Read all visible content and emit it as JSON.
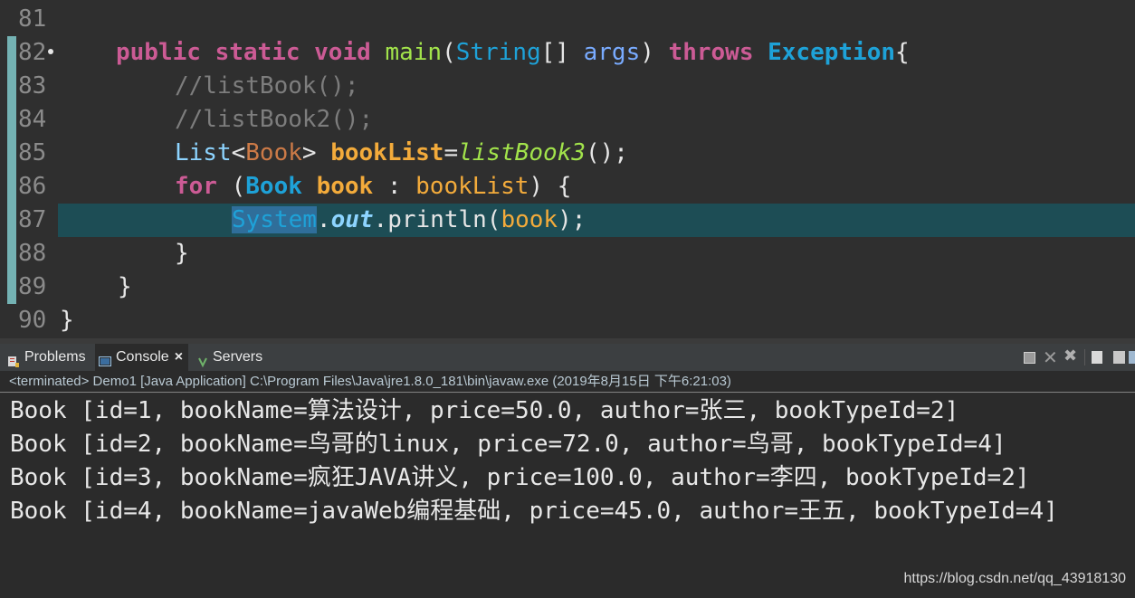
{
  "editor": {
    "line_numbers": [
      "81",
      "82",
      "83",
      "84",
      "85",
      "86",
      "87",
      "88",
      "89",
      "90"
    ],
    "line82": {
      "public": "public",
      "static": "static",
      "void": "void",
      "main": "main",
      "paren": "(",
      "string": "String",
      "arr": "[] ",
      "args": "args",
      "close": ") ",
      "throws": "throws",
      "exception": "Exception",
      "brace": "{"
    },
    "line83": "//listBook();",
    "line84": "//listBook2();",
    "line85": {
      "list": "List",
      "lt": "<",
      "book": "Book",
      "gt": "> ",
      "var": "bookList",
      "eq": "=",
      "call": "listBook3",
      "end": "();"
    },
    "line86": {
      "for": "for",
      "open": " (",
      "book": "Book",
      "var": "book",
      "colon": " : ",
      "list": "bookList",
      "close": ") {"
    },
    "line87": {
      "system": "System",
      "dot": ".",
      "out": "out",
      "dot2": ".",
      "println": "println(",
      "arg": "book",
      "end": ");"
    },
    "line88": "}",
    "line89": "}",
    "line90": "}"
  },
  "tabs": {
    "problems": "Problems",
    "console": "Console",
    "console_close": "×",
    "servers": "Servers"
  },
  "status": "<terminated> Demo1 [Java Application] C:\\Program Files\\Java\\jre1.8.0_181\\bin\\javaw.exe (2019年8月15日 下午6:21:03)",
  "console_lines": [
    "Book [id=1, bookName=算法设计, price=50.0, author=张三, bookTypeId=2]",
    "Book [id=2, bookName=鸟哥的linux, price=72.0, author=鸟哥, bookTypeId=4]",
    "Book [id=3, bookName=疯狂JAVA讲义, price=100.0, author=李四, bookTypeId=2]",
    "Book [id=4, bookName=javaWeb编程基础, price=45.0, author=王五, bookTypeId=4]"
  ],
  "watermark": "https://blog.csdn.net/qq_43918130",
  "colors": {
    "keyword": "#cc5b95",
    "type": "#1ea2d8",
    "method": "#a2e34b",
    "local_var": "#f3ab3b",
    "comment": "#7d7d7d",
    "highlight_line": "#1d4d55"
  }
}
